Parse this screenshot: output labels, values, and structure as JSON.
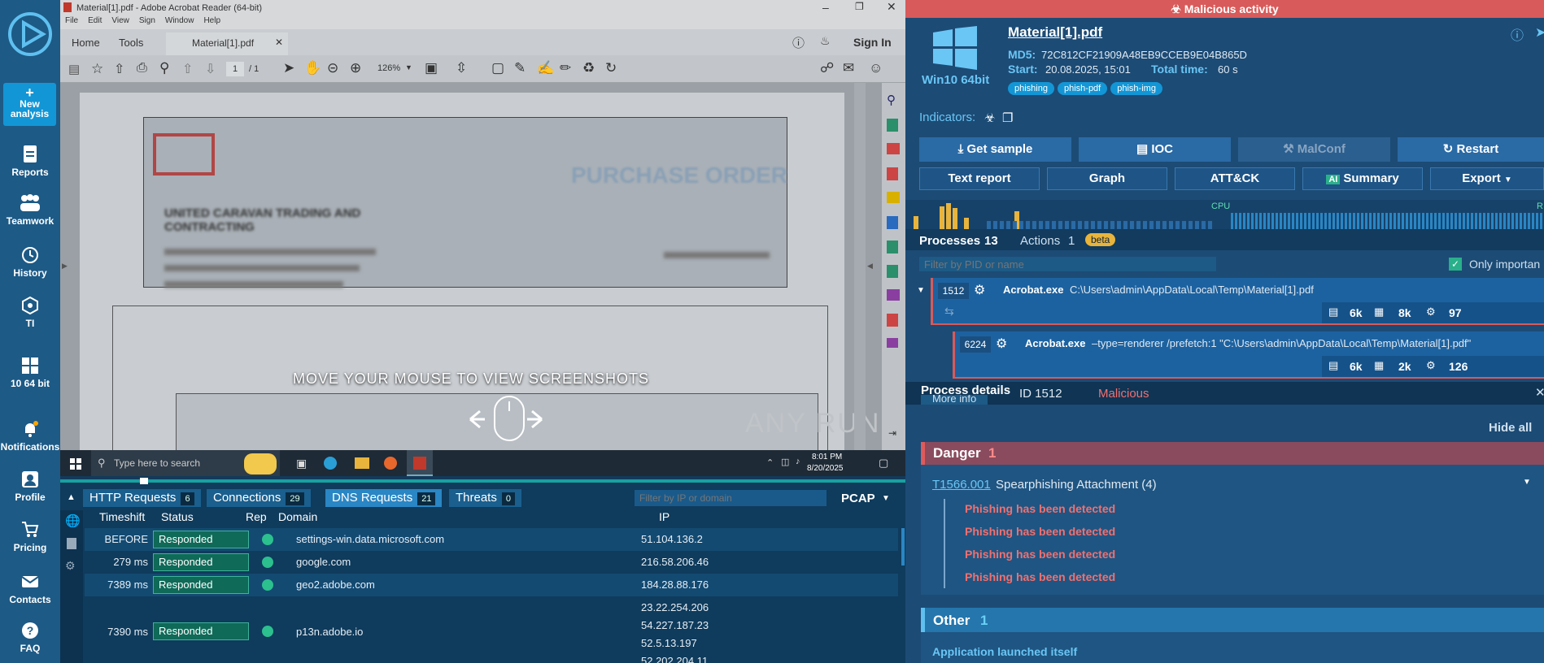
{
  "sidebar": {
    "items": [
      {
        "label": "Reports"
      },
      {
        "label": "Teamwork"
      },
      {
        "label": "History"
      },
      {
        "label": "TI"
      },
      {
        "label": "10 64 bit"
      },
      {
        "label": "Notifications"
      },
      {
        "label": "Profile"
      },
      {
        "label": "Pricing"
      },
      {
        "label": "Contacts"
      },
      {
        "label": "FAQ"
      }
    ],
    "new_analysis": "New analysis"
  },
  "acrobat": {
    "title": "Material[1].pdf - Adobe Acrobat Reader (64-bit)",
    "menu": [
      "File",
      "Edit",
      "View",
      "Sign",
      "Window",
      "Help"
    ],
    "tabs": {
      "home": "Home",
      "tools": "Tools",
      "doc": "Material[1].pdf"
    },
    "sign_in": "Sign In",
    "page": "1",
    "pages": "/ 1",
    "zoom": "126%",
    "doc_heading": "PURCHASE ORDER",
    "company": "UNITED CARAVAN TRADING AND CONTRACTING",
    "overlay": "MOVE YOUR MOUSE TO VIEW SCREENSHOTS",
    "watermark": "ANY RUN"
  },
  "taskbar": {
    "search": "Type here to search",
    "time": "8:01 PM",
    "date": "8/20/2025"
  },
  "network": {
    "tabs": [
      {
        "label": "HTTP Requests",
        "count": "6"
      },
      {
        "label": "Connections",
        "count": "29"
      },
      {
        "label": "DNS Requests",
        "count": "21"
      },
      {
        "label": "Threats",
        "count": "0"
      }
    ],
    "filter_placeholder": "Filter by IP or domain",
    "pcap": "PCAP",
    "headers": {
      "timeshift": "Timeshift",
      "status": "Status",
      "rep": "Rep",
      "domain": "Domain",
      "ip": "IP"
    },
    "rows": [
      {
        "time": "BEFORE",
        "status": "Responded",
        "domain": "settings-win.data.microsoft.com",
        "ip": "51.104.136.2"
      },
      {
        "time": "279 ms",
        "status": "Responded",
        "domain": "google.com",
        "ip": "216.58.206.46"
      },
      {
        "time": "7389 ms",
        "status": "Responded",
        "domain": "geo2.adobe.com",
        "ip": "184.28.88.176"
      },
      {
        "time": "7390 ms",
        "status": "Responded",
        "domain": "p13n.adobe.io",
        "ip": "23.22.254.206",
        "ips2": "54.227.187.23",
        "ips3": "52.5.13.197",
        "ips4": "52.202.204.11"
      }
    ]
  },
  "report": {
    "banner": "Malicious activity",
    "filename": "Material[1].pdf",
    "os": "Win10 64bit",
    "md5_label": "MD5:",
    "md5": "72C812CF21909A48EB9CCEB9E04B865D",
    "start_label": "Start:",
    "start": "20.08.2025, 15:01",
    "total_label": "Total time:",
    "total": "60 s",
    "tags": [
      "phishing",
      "phish-pdf",
      "phish-img"
    ],
    "indicators": "Indicators:",
    "buttons": {
      "get_sample": "Get sample",
      "ioc": "IOC",
      "malconf": "MalConf",
      "restart": "Restart",
      "text_report": "Text report",
      "graph": "Graph",
      "attck": "ATT&CK",
      "summary": "Summary",
      "export": "Export"
    },
    "cpu": "CPU",
    "ram": "R",
    "processes_label": "Processes",
    "processes_count": "13",
    "actions_label": "Actions",
    "actions_count": "1",
    "beta": "beta",
    "filter_pid": "Filter by PID or name",
    "only_important": "Only importan",
    "procs": [
      {
        "pid": "1512",
        "name": "Acrobat.exe",
        "args": "C:\\Users\\admin\\AppData\\Local\\Temp\\Material[1].pdf",
        "s1": "6k",
        "s2": "8k",
        "s3": "97"
      },
      {
        "pid": "6224",
        "name": "Acrobat.exe",
        "args": "–type=renderer /prefetch:1 \"C:\\Users\\admin\\AppData\\Local\\Temp\\Material[1].pdf\"",
        "s1": "6k",
        "s2": "2k",
        "s3": "126"
      }
    ],
    "details": {
      "title": "Process details",
      "id": "ID 1512",
      "verdict": "Malicious",
      "more": "More info",
      "hide_all": "Hide all"
    },
    "danger": {
      "label": "Danger",
      "count": "1",
      "technique": "T1566.001",
      "technique_name": "Spearphishing Attachment (4)",
      "lines": [
        "Phishing has been detected",
        "Phishing has been detected",
        "Phishing has been detected",
        "Phishing has been detected"
      ]
    },
    "other": {
      "label": "Other",
      "count": "1",
      "line": "Application launched itself"
    }
  }
}
